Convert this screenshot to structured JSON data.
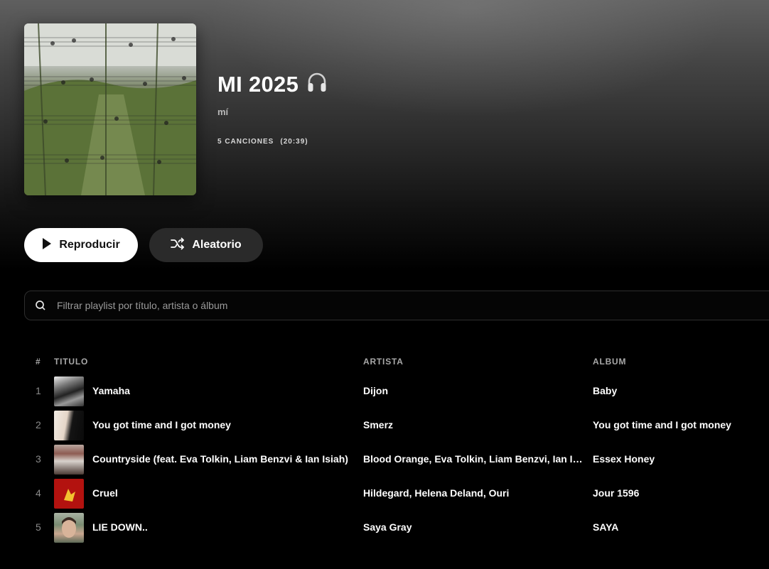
{
  "header": {
    "title": "MI 2025",
    "title_icon": "headphones-icon",
    "owner": "mí",
    "song_count": "5 CANCIONES",
    "duration": "(20:39)"
  },
  "actions": {
    "play_label": "Reproducir",
    "shuffle_label": "Aleatorio"
  },
  "filter": {
    "placeholder": "Filtrar playlist por título, artista o álbum",
    "value": ""
  },
  "table": {
    "headers": {
      "num": "#",
      "title": "TITULO",
      "artist": "ARTISTA",
      "album": "ALBUM"
    },
    "rows": [
      {
        "num": "1",
        "title": "Yamaha",
        "artist": "Dijon",
        "album": "Baby"
      },
      {
        "num": "2",
        "title": "You got time and I got money",
        "artist": "Smerz",
        "album": "You got time and I got money"
      },
      {
        "num": "3",
        "title": "Countryside (feat. Eva Tolkin, Liam Benzvi & Ian Isiah)",
        "artist": "Blood Orange, Eva Tolkin, Liam Benzvi, Ian Isi...",
        "album": "Essex Honey"
      },
      {
        "num": "4",
        "title": "Cruel",
        "artist": "Hildegard, Helena Deland, Ouri",
        "album": "Jour 1596"
      },
      {
        "num": "5",
        "title": "LIE DOWN..",
        "artist": "Saya Gray",
        "album": "SAYA"
      }
    ]
  },
  "colors": {
    "play_button_bg": "#ffffff",
    "shuffle_button_bg": "#2a2a2a",
    "page_bg": "#000000"
  }
}
